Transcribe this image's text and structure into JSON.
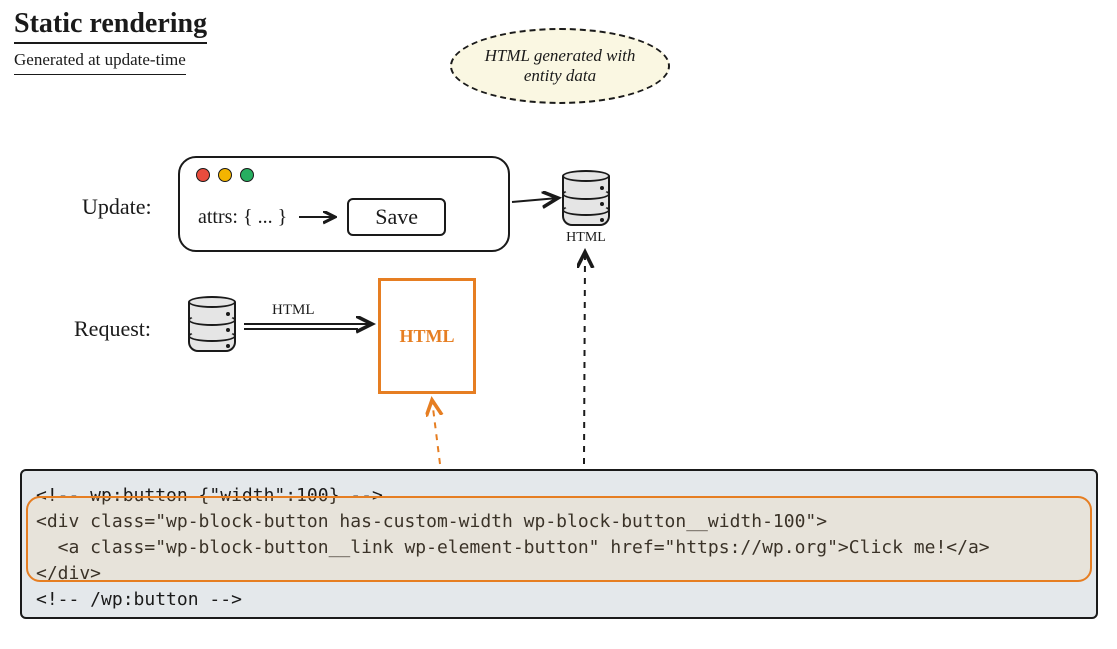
{
  "title": "Static rendering",
  "subtitle": "Generated at update-time",
  "callout": "HTML generated with entity data",
  "labels": {
    "update": "Update:",
    "request": "Request:"
  },
  "window": {
    "attrs": "attrs: { ... }",
    "save": "Save"
  },
  "db": {
    "top_caption": "HTML",
    "request_arrow_label": "HTML"
  },
  "html_box": "HTML",
  "code": {
    "l1": "<!-- wp:button {\"width\":100} -->",
    "l2": "<div class=\"wp-block-button has-custom-width wp-block-button__width-100\">",
    "l3": "  <a class=\"wp-block-button__link wp-element-button\" href=\"https://wp.org\">Click me!</a>",
    "l4": "</div>",
    "l5": "<!-- /wp:button -->"
  }
}
